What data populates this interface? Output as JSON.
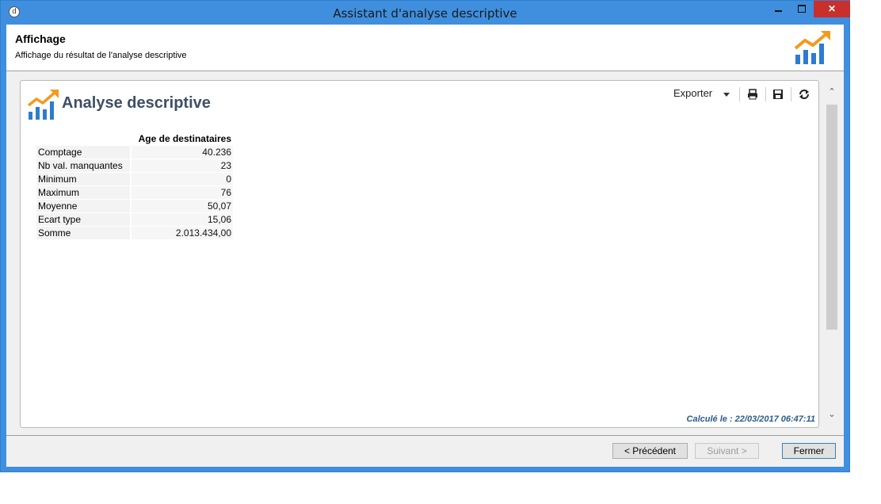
{
  "window": {
    "title": "Assistant d'analyse descriptive",
    "app_icon_glyph": "d",
    "close_glyph": "✕"
  },
  "header": {
    "title": "Affichage",
    "subtitle": "Affichage du résultat de l'analyse descriptive",
    "logo_icon": "analysis-chart-icon"
  },
  "toolbar": {
    "export_label": "Exporter",
    "print_icon": "print-icon",
    "save_icon": "save-icon",
    "refresh_icon": "refresh-icon"
  },
  "report": {
    "title": "Analyse descriptive",
    "column_header": "Age de destinataires",
    "rows": [
      {
        "label": "Comptage",
        "value": "40.236"
      },
      {
        "label": "Nb val. manquantes",
        "value": "23"
      },
      {
        "label": "Minimum",
        "value": "0"
      },
      {
        "label": "Maximum",
        "value": "76"
      },
      {
        "label": "Moyenne",
        "value": "50,07"
      },
      {
        "label": "Ecart type",
        "value": "15,06"
      },
      {
        "label": "Somme",
        "value": "2.013.434,00"
      }
    ],
    "calculated": "Calculé le : 22/03/2017 06:47:11"
  },
  "footer": {
    "prev_label": "< Précédent",
    "next_label": "Suivant >",
    "close_label": "Fermer"
  },
  "colors": {
    "title_bar": "#3f8fde",
    "close_button": "#c9302c",
    "report_title": "#3d4f66",
    "logo_orange": "#f39a1e",
    "logo_blue": "#2e7bcf",
    "calc_text": "#2d5c8a"
  }
}
